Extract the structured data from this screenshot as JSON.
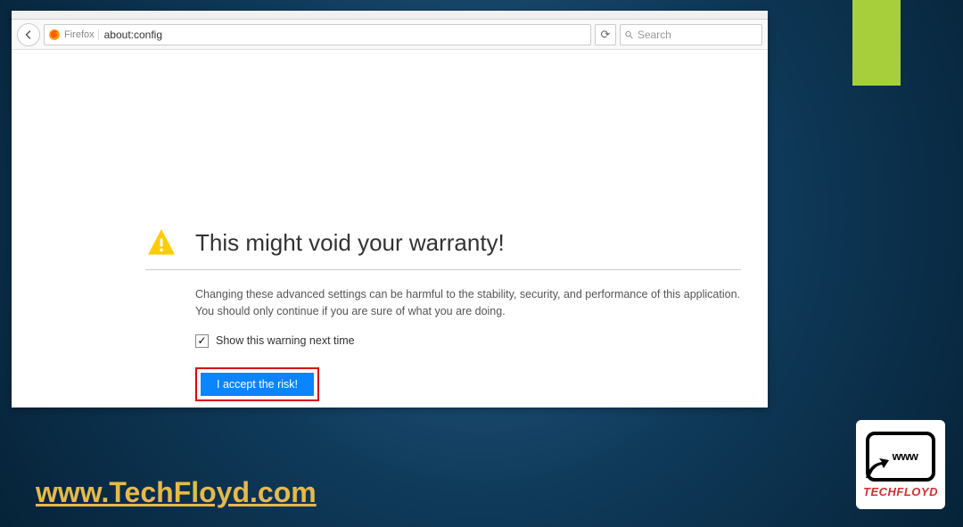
{
  "toolbar": {
    "browser_label": "Firefox",
    "url": "about:config",
    "search_placeholder": "Search"
  },
  "warning": {
    "title": "This might void your warranty!",
    "body": "Changing these advanced settings can be harmful to the stability, security, and performance of this application. You should only continue if you are sure of what you are doing.",
    "checkbox_label": "Show this warning next time",
    "checkbox_checked": true,
    "accept_label": "I accept the risk!"
  },
  "overlay": {
    "footer_url": "www.TechFloyd.com",
    "logo_www": "www",
    "logo_brand": "TECHFLOYD"
  },
  "colors": {
    "accent": "#0a84ff",
    "highlight_border": "#d80000",
    "footer_text": "#e6b94a",
    "green_tab": "#a7cf3b"
  }
}
